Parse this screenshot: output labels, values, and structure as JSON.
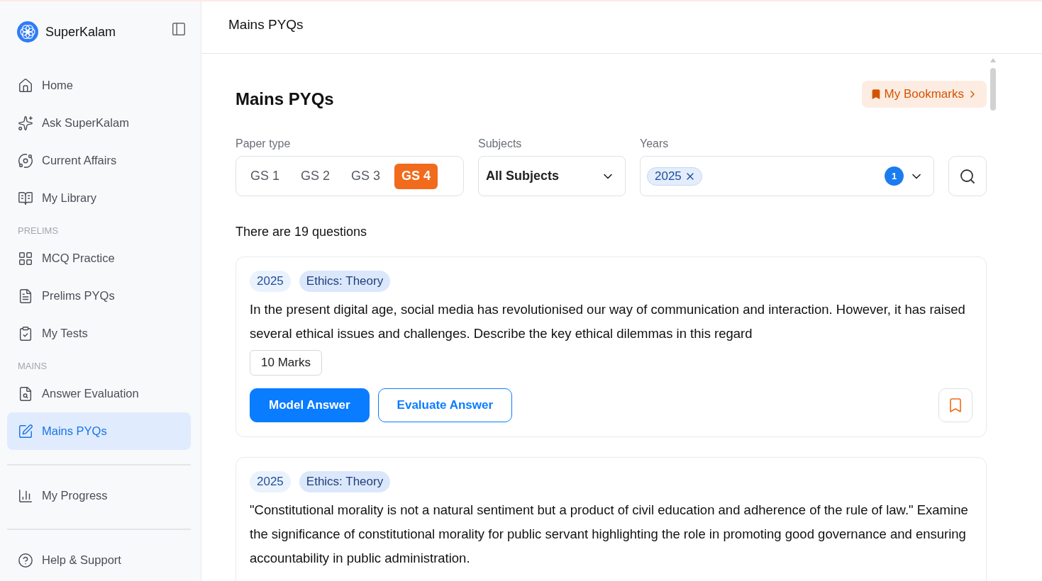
{
  "sidebar": {
    "brand": "SuperKalam",
    "groups": [
      {
        "divider": false,
        "items": [
          {
            "label": "Home",
            "selected": false
          },
          {
            "label": "Ask SuperKalam",
            "selected": false
          },
          {
            "label": "Current Affairs",
            "selected": false
          },
          {
            "label": "My Library",
            "selected": false
          }
        ]
      },
      {
        "divider": false,
        "heading": "PRELIMS",
        "items": [
          {
            "label": "MCQ Practice",
            "selected": false
          },
          {
            "label": "Prelims PYQs",
            "selected": false
          },
          {
            "label": "My Tests",
            "selected": false
          }
        ]
      },
      {
        "divider": false,
        "heading": "MAINS",
        "items": [
          {
            "label": "Answer Evaluation",
            "selected": false
          },
          {
            "label": "Mains PYQs",
            "selected": true
          }
        ]
      },
      {
        "divider": true,
        "items": [
          {
            "label": "My Progress",
            "selected": false
          }
        ]
      },
      {
        "divider": true,
        "items": [
          {
            "label": "Help & Support",
            "selected": false
          }
        ]
      }
    ]
  },
  "header": {
    "title": "Mains PYQs"
  },
  "page": {
    "title": "Mains PYQs",
    "bookmarks_button": "My Bookmarks"
  },
  "filters": {
    "paper_type": {
      "label": "Paper type",
      "options": [
        {
          "label": "GS 1",
          "selected": false
        },
        {
          "label": "GS 2",
          "selected": false
        },
        {
          "label": "GS 3",
          "selected": false
        },
        {
          "label": "GS 4",
          "selected": true
        }
      ]
    },
    "subjects": {
      "label": "Subjects",
      "value": "All Subjects"
    },
    "years": {
      "label": "Years",
      "chips": [
        "2025"
      ],
      "count": "1"
    }
  },
  "summary": "There are 19 questions",
  "questions": [
    {
      "year": "2025",
      "topic": "Ethics: Theory",
      "text": "In the present digital age, social media has revolutionised our way of communication and interaction. However, it has raised several ethical issues and challenges. Describe the key ethical dilemmas in this regard",
      "marks": "10 Marks",
      "actions": [
        "Model Answer",
        "Evaluate Answer"
      ],
      "bookmarked": false
    },
    {
      "year": "2025",
      "topic": "Ethics: Theory",
      "text": "\"Constitutional morality is not a natural sentiment but a product of civil education and adherence of the rule of law.\" Examine the significance of constitutional morality for public servant highlighting the role in promoting good governance and ensuring accountability in public administration."
    }
  ]
}
